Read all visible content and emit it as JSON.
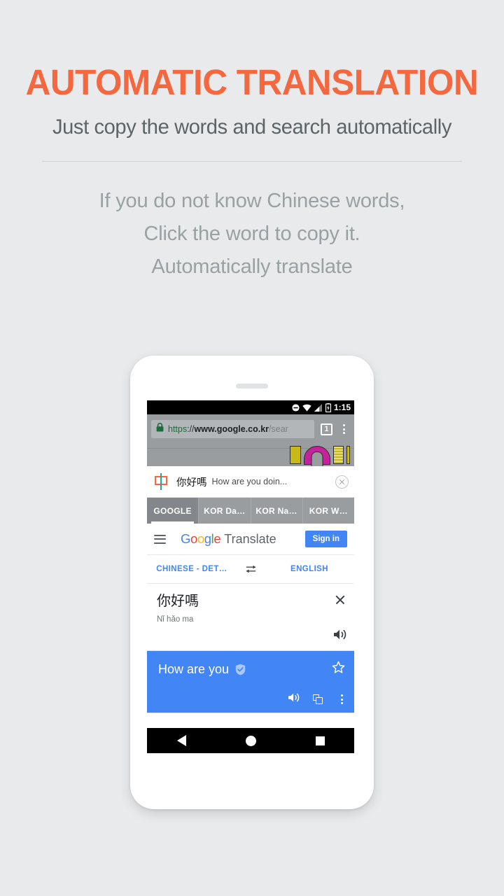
{
  "promo": {
    "title": "AUTOMATIC TRANSLATION",
    "subtitle": "Just copy the words and search automatically",
    "body_line1": "If you do not know Chinese words,",
    "body_line2": "Click the word to copy it.",
    "body_line3": "Automatically translate",
    "accent_color": "#f4683f",
    "background_color": "#e8eaeb"
  },
  "phone": {
    "statusbar": {
      "time": "1:15",
      "icons": [
        "do-not-disturb-icon",
        "wifi-icon",
        "signal-icon",
        "battery-charging-icon"
      ]
    },
    "browser": {
      "lock_icon": "lock-icon",
      "url_scheme": "https",
      "url_separator": "://",
      "url_host": "www.google.co.kr",
      "url_path": "/sear",
      "tab_count": "1",
      "menu_icon": "kebab-menu-icon"
    },
    "overlay": {
      "lang_icon": "chinese-character-icon",
      "source_text": "你好嗎",
      "translated_preview": "How are you doin...",
      "close_icon": "close-circle-icon"
    },
    "site_tabs": [
      {
        "label": "GOOGLE",
        "active": true
      },
      {
        "label": "KOR Da…",
        "active": false
      },
      {
        "label": "KOR Na…",
        "active": false
      },
      {
        "label": "KOR W…",
        "active": false
      }
    ],
    "translate": {
      "menu_icon": "hamburger-menu-icon",
      "logo_letters": [
        "G",
        "o",
        "o",
        "g",
        "l",
        "e"
      ],
      "product_word": "Translate",
      "signin_label": "Sign in",
      "source_lang": "CHINESE - DET…",
      "swap_icon": "swap-arrows-icon",
      "target_lang": "ENGLISH",
      "source_text": "你好嗎",
      "source_transliteration": "Nǐ hǎo ma",
      "source_clear_icon": "close-icon",
      "source_speak_icon": "speaker-icon",
      "result_text": "How are you",
      "result_verified_icon": "verified-badge-icon",
      "result_star_icon": "star-icon",
      "result_speak_icon": "speaker-icon",
      "result_copy_icon": "copy-icon",
      "result_menu_icon": "kebab-menu-icon",
      "accent_color": "#4285f4"
    },
    "navbar": {
      "back_icon": "back-triangle-icon",
      "home_icon": "home-circle-icon",
      "recents_icon": "recents-square-icon"
    }
  }
}
